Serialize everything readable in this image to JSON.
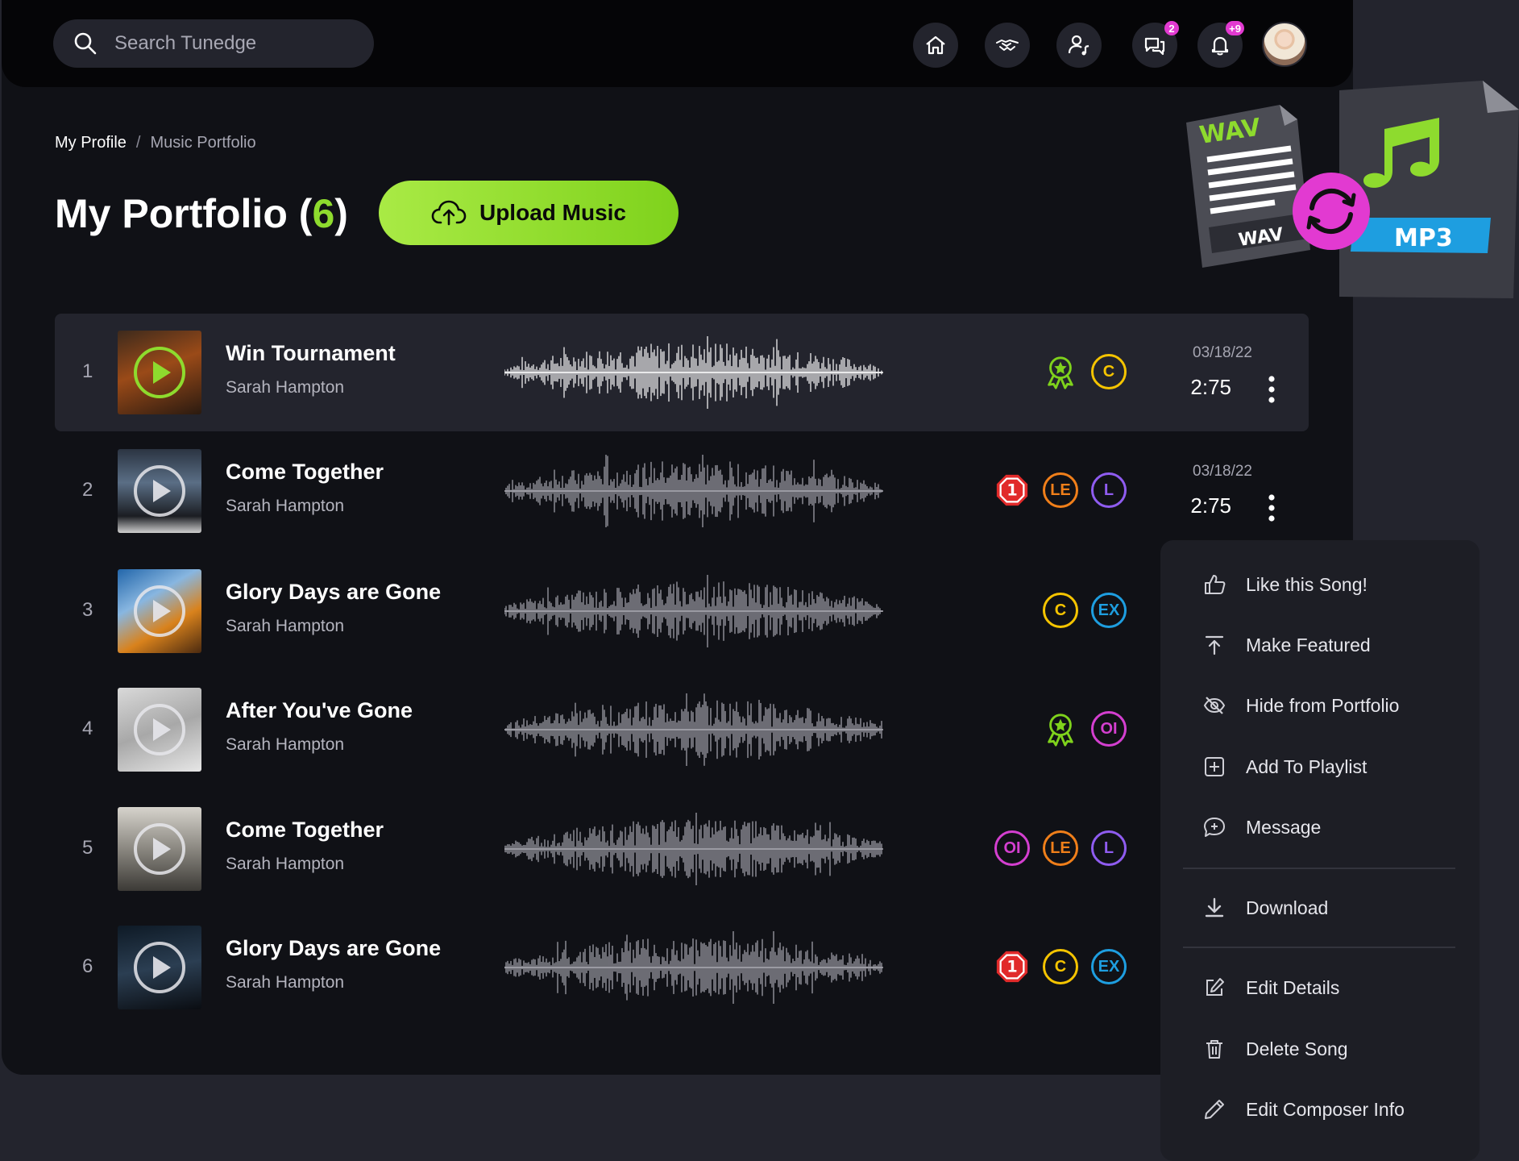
{
  "search": {
    "placeholder": "Search Tunedge"
  },
  "nav": {
    "icons": [
      "home-icon",
      "handshake-icon",
      "user-music-icon",
      "chat-icon",
      "bell-icon"
    ],
    "messages_badge": "2",
    "notifications_badge": "+9"
  },
  "breadcrumb": {
    "parent": "My Profile",
    "separator": "/",
    "current": "Music Portfolio"
  },
  "page": {
    "title": "My Portfolio",
    "count_open": "(",
    "count": "6",
    "count_close": ")"
  },
  "upload": {
    "label": "Upload Music"
  },
  "file_graphic": {
    "wav_label": "WAV",
    "wav_label_bottom": "WAV",
    "mp3_label": "MP3"
  },
  "tracks": [
    {
      "num": "1",
      "title": "Win Tournament",
      "artist": "Sarah Hampton",
      "date": "03/18/22",
      "duration": "2:75",
      "tags": [
        "award",
        "C"
      ]
    },
    {
      "num": "2",
      "title": "Come Together",
      "artist": "Sarah Hampton",
      "date": "03/18/22",
      "duration": "2:75",
      "tags": [
        "1",
        "LE",
        "L"
      ]
    },
    {
      "num": "3",
      "title": "Glory Days are Gone",
      "artist": "Sarah Hampton",
      "tags": [
        "C",
        "EX"
      ]
    },
    {
      "num": "4",
      "title": "After You've Gone",
      "artist": "Sarah Hampton",
      "tags": [
        "award",
        "OI"
      ]
    },
    {
      "num": "5",
      "title": "Come Together",
      "artist": "Sarah Hampton",
      "tags": [
        "OI",
        "LE",
        "L"
      ]
    },
    {
      "num": "6",
      "title": "Glory Days are Gone",
      "artist": "Sarah Hampton",
      "tags": [
        "1",
        "C",
        "EX"
      ]
    }
  ],
  "menu": {
    "like": "Like this Song!",
    "featured": "Make Featured",
    "hide": "Hide from Portfolio",
    "playlist": "Add To Playlist",
    "message": "Message",
    "download": "Download",
    "edit": "Edit Details",
    "delete": "Delete Song",
    "composer": "Edit Composer Info"
  },
  "colors": {
    "accent_green": "#8edb2e",
    "tag_C": "#f5c400",
    "tag_LE": "#f07f1a",
    "tag_L": "#8f5cf0",
    "tag_EX": "#1e9ee0",
    "tag_OI": "#d43fd0",
    "tag_1": "#e12a2a",
    "badge_pink": "#e23ad1"
  }
}
